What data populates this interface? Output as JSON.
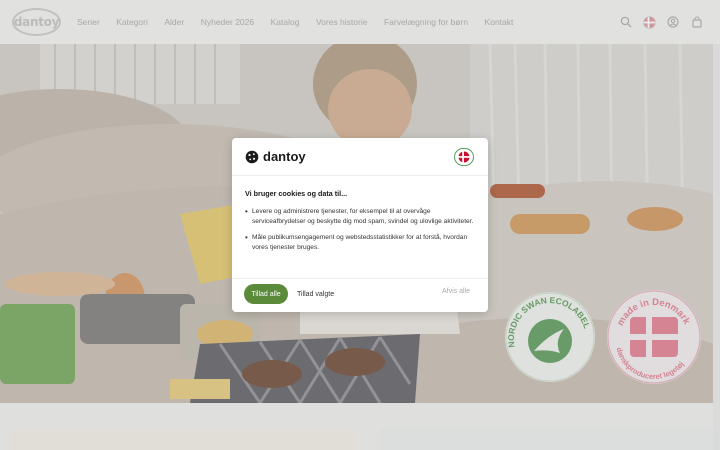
{
  "header": {
    "logo_text": "dantoy",
    "nav": [
      {
        "label": "Serier"
      },
      {
        "label": "Kategori"
      },
      {
        "label": "Alder"
      },
      {
        "label": "Nyheder 2026"
      },
      {
        "label": "Katalog"
      },
      {
        "label": "Vores historie"
      },
      {
        "label": "Farvelægning for børn"
      },
      {
        "label": "Kontakt"
      }
    ],
    "icons": [
      "search-icon",
      "danish-flag-icon",
      "user-icon",
      "cart-icon"
    ]
  },
  "hero": {
    "badge_left_text": "NORDIC SWAN ECOLABEL",
    "badge_right_top_text": "made in Denmark",
    "badge_right_bottom_text": "danskproduceret legetøj"
  },
  "cookie_modal": {
    "brand": "dantoy",
    "title": "Vi bruger cookies og data til...",
    "purposes": [
      "Levere og administrere tjenester, for eksempel til at overvåge serviceafbrydelser og beskytte dig mod spam, svindel og ulovlige aktiviteter.",
      "Måle publikumsengagement og webstedsstatistikker for at forstå, hvordan vores tjenester bruges."
    ],
    "accept_all_label": "Tillad alle",
    "allow_selected_label": "Tillad valgte",
    "reject_all_label": "Afvis alle"
  },
  "colors": {
    "accent_green": "#5a8a3a",
    "flag_red": "#c8102e",
    "badge_green": "#5c9a5c"
  }
}
